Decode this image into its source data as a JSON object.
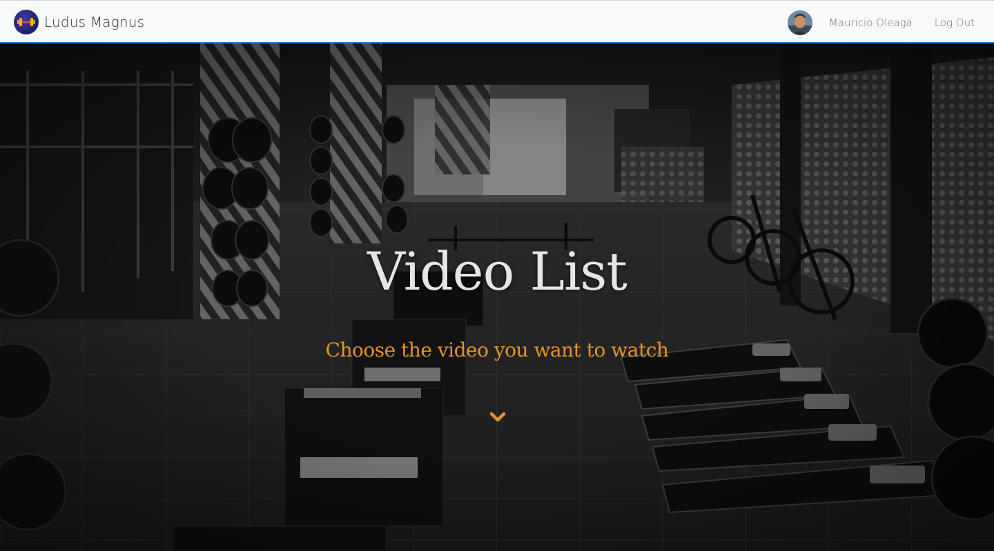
{
  "navbar": {
    "brand_name": "Ludus Magnus",
    "brand_logo_icon": "dumbbell-icon",
    "user_name": "Mauricio Oleaga",
    "logout_label": "Log Out",
    "accent_color": "#2f7fcf"
  },
  "hero": {
    "title": "Video List",
    "subtitle": "Choose the video you want to watch",
    "scroll_icon": "chevron-down-icon",
    "subtitle_color": "#e8922a"
  }
}
